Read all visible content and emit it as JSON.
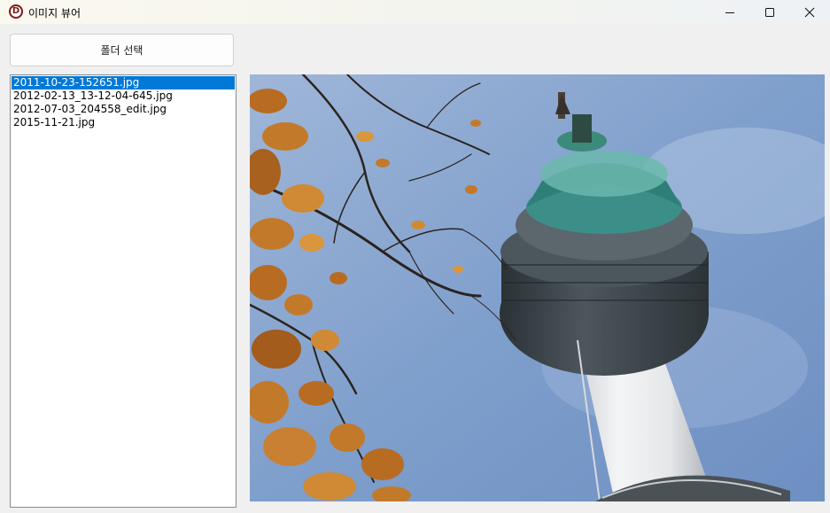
{
  "window": {
    "title": "이미지 뷰어",
    "app_icon_letter": "D"
  },
  "toolbar": {
    "folder_button_label": "폴더 선택"
  },
  "file_list": {
    "items": [
      {
        "name": "2011-10-23-152651.jpg",
        "selected": true
      },
      {
        "name": "2012-02-13_13-12-04-645.jpg",
        "selected": false
      },
      {
        "name": "2012-07-03_204558_edit.jpg",
        "selected": false
      },
      {
        "name": "2015-11-21.jpg",
        "selected": false
      }
    ]
  },
  "viewer": {
    "image_subject": "n-seoul-tower-photo"
  },
  "colors": {
    "selection": "#0078d7",
    "sky": "#8fadd8",
    "tower_cap": "#3a9a8e",
    "leaves": "#c27a2a"
  }
}
